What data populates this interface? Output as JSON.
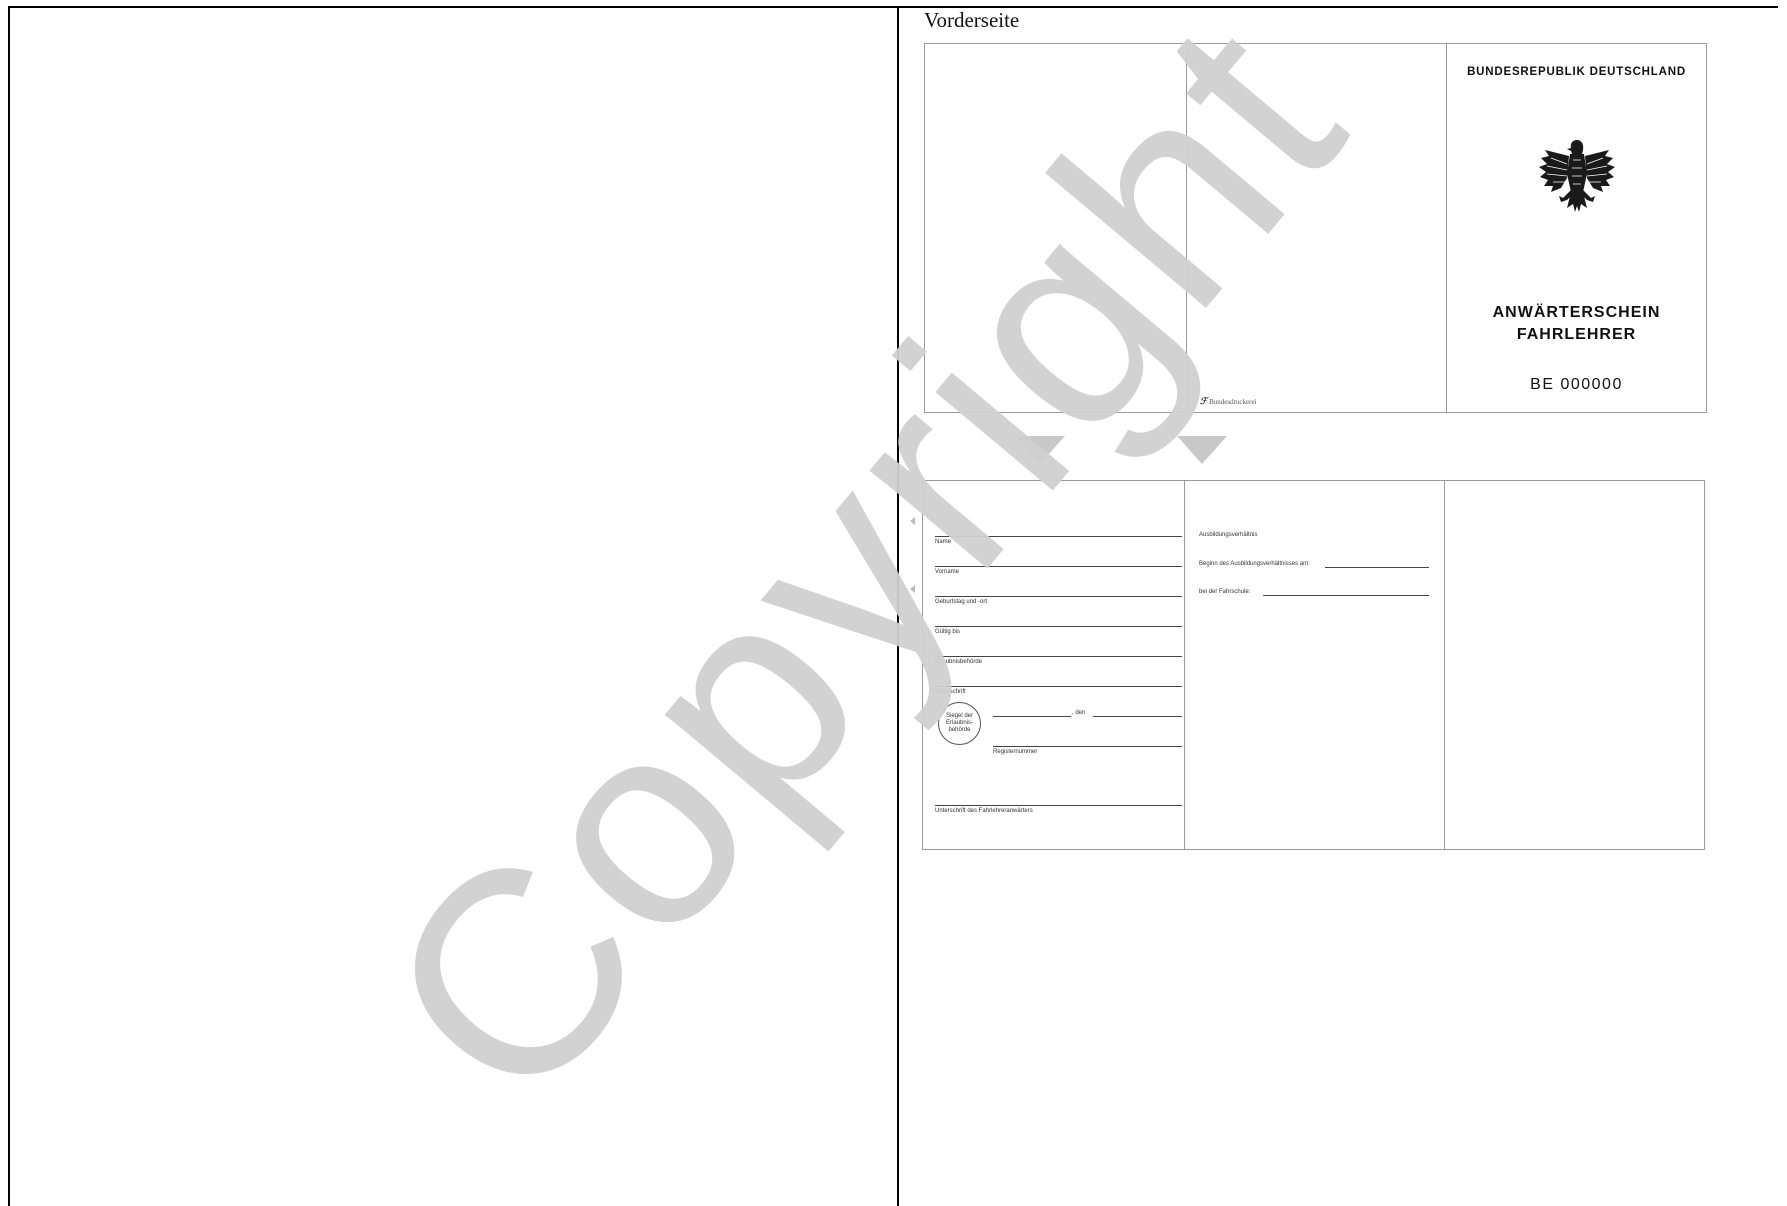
{
  "document": {
    "heading": "Vorderseite",
    "watermark": "Copyright"
  },
  "front_card": {
    "country": "BUNDESREPUBLIK DEUTSCHLAND",
    "title_line1": "ANWÄRTERSCHEIN",
    "title_line2": "FAHRLEHRER",
    "serial": "BE 000000",
    "printer": "Bundesdruckerei",
    "emblem_icon": "federal-eagle-icon"
  },
  "back_card": {
    "fields": [
      "Name",
      "Vorname",
      "Geburtstag und -ort",
      "Gültig bis",
      "Erlaubnisbehörde",
      "Unterschrift"
    ],
    "seal_text": "Siegel der Erlaubnis-behörde",
    "date_sep": ", den",
    "register_label": "Registernummer",
    "candidate_signature": "Unterschrift des Fahrlehreranwärters",
    "middle_title": "Ausbildungsverhältnis",
    "middle_start": "Beginn des Ausbildungsverhältnisses am:",
    "middle_school": "bei der Fahrschule:"
  }
}
